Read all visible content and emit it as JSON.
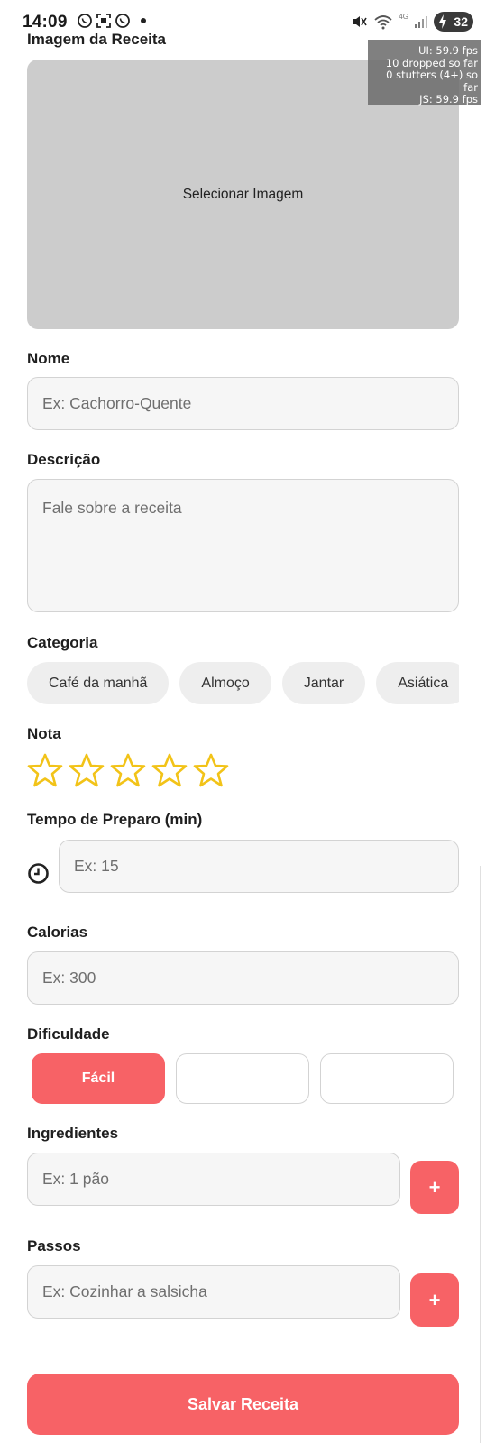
{
  "status_bar": {
    "time": "14:09",
    "battery_level": "32",
    "network_label": "4G",
    "icons": [
      "whatsapp-icon",
      "screenshot-icon",
      "whatsapp-icon",
      "mute-icon",
      "wifi-icon",
      "signal-icon",
      "battery-icon"
    ]
  },
  "perf_overlay": {
    "ui_fps": "UI: 59.9 fps",
    "dropped": "10 dropped so far",
    "stutters": "0 stutters (4+) so far",
    "js_fps": "JS: 59.9 fps"
  },
  "form": {
    "image": {
      "label": "Imagem da Receita",
      "button": "Selecionar Imagem"
    },
    "name": {
      "label": "Nome",
      "placeholder": "Ex: Cachorro-Quente",
      "value": ""
    },
    "description": {
      "label": "Descrição",
      "placeholder": "Fale sobre a receita",
      "value": ""
    },
    "category": {
      "label": "Categoria",
      "options": [
        "Café da manhã",
        "Almoço",
        "Jantar",
        "Asiática"
      ]
    },
    "rating": {
      "label": "Nota",
      "value": 0,
      "max": 5
    },
    "prep_time": {
      "label": "Tempo de Preparo (min)",
      "placeholder": "Ex: 15",
      "value": ""
    },
    "calories": {
      "label": "Calorias",
      "placeholder": "Ex: 300",
      "value": ""
    },
    "difficulty": {
      "label": "Dificuldade",
      "options": [
        "Fácil",
        "",
        ""
      ],
      "selected": "Fácil"
    },
    "ingredients": {
      "label": "Ingredientes",
      "placeholder": "Ex: 1 pão",
      "add_label": "+"
    },
    "steps": {
      "label": "Passos",
      "placeholder": "Ex: Cozinhar a salsicha",
      "add_label": "+"
    },
    "submit_label": "Salvar Receita"
  },
  "colors": {
    "accent": "#f76266",
    "star": "#f2c318",
    "image_placeholder": "#cccccc",
    "input_background": "#f6f6f6",
    "input_border": "#d3d3d3"
  }
}
